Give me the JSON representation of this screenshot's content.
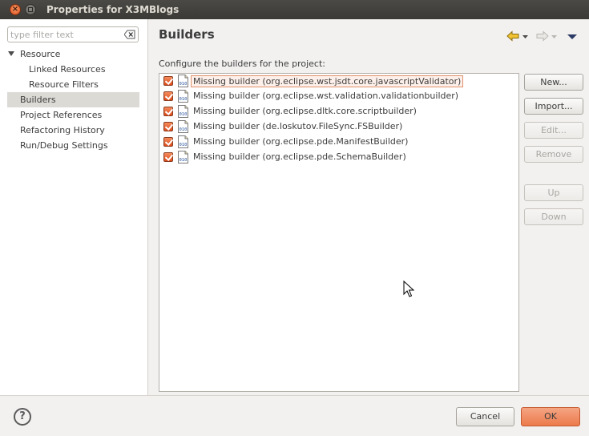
{
  "window": {
    "title": "Properties for X3MBlogs"
  },
  "filter": {
    "placeholder": "type filter text"
  },
  "tree": {
    "items": [
      {
        "label": "Resource",
        "level": 0,
        "expanded": true
      },
      {
        "label": "Linked Resources",
        "level": 1
      },
      {
        "label": "Resource Filters",
        "level": 1
      },
      {
        "label": "Builders",
        "level": 0,
        "selected": true
      },
      {
        "label": "Project References",
        "level": 0
      },
      {
        "label": "Refactoring History",
        "level": 0
      },
      {
        "label": "Run/Debug Settings",
        "level": 0
      }
    ]
  },
  "page": {
    "title": "Builders",
    "description": "Configure the builders for the project:"
  },
  "builders": [
    {
      "label": "Missing builder (org.eclipse.wst.jsdt.core.javascriptValidator)",
      "checked": true,
      "focused": true
    },
    {
      "label": "Missing builder (org.eclipse.wst.validation.validationbuilder)",
      "checked": true
    },
    {
      "label": "Missing builder (org.eclipse.dltk.core.scriptbuilder)",
      "checked": true
    },
    {
      "label": "Missing builder (de.loskutov.FileSync.FSBuilder)",
      "checked": true
    },
    {
      "label": "Missing builder (org.eclipse.pde.ManifestBuilder)",
      "checked": true
    },
    {
      "label": "Missing builder (org.eclipse.pde.SchemaBuilder)",
      "checked": true
    }
  ],
  "buttons": {
    "new": "New...",
    "import": "Import...",
    "edit": "Edit...",
    "remove": "Remove",
    "up": "Up",
    "down": "Down"
  },
  "footer": {
    "help": "?",
    "cancel": "Cancel",
    "ok": "OK"
  },
  "colors": {
    "accent": "#ec7a4b",
    "titlebar": "#3c3b37",
    "checkbox": "#df4d1c"
  }
}
